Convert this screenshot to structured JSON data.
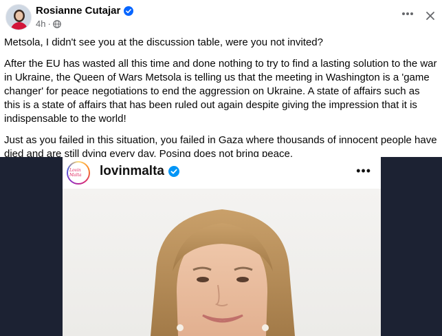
{
  "post": {
    "author": "Rosianne Cutajar",
    "time": "4h",
    "separator": "·",
    "paragraphs": [
      "Metsola, I didn't see you at the discussion table, were you not invited?",
      "After the EU has wasted all this time and done nothing to try to find a lasting solution to the war in Ukraine, the Queen of Wars Metsola is telling us that the meeting in Washington is a 'game changer' for peace negotiations to end the aggression on Ukraine. A state of affairs such as this is a state of affairs that has been ruled out again despite giving the impression that it is indispensable to the world!",
      "Just as you failed in this situation, you failed in Gaza where thousands of innocent people have died and are still dying every day. Posing does not bring peace."
    ]
  },
  "embedded": {
    "account": "lovinmalta",
    "avatar_text": "Lovin Malta",
    "more": "•••"
  },
  "icons": {
    "verified": "verified-badge-icon",
    "audience": "globe-icon",
    "more": "more-options-icon",
    "close": "close-icon"
  },
  "colors": {
    "verified_blue": "#0866ff",
    "ig_verified_blue": "#0095f6",
    "media_background": "#1c2233"
  }
}
